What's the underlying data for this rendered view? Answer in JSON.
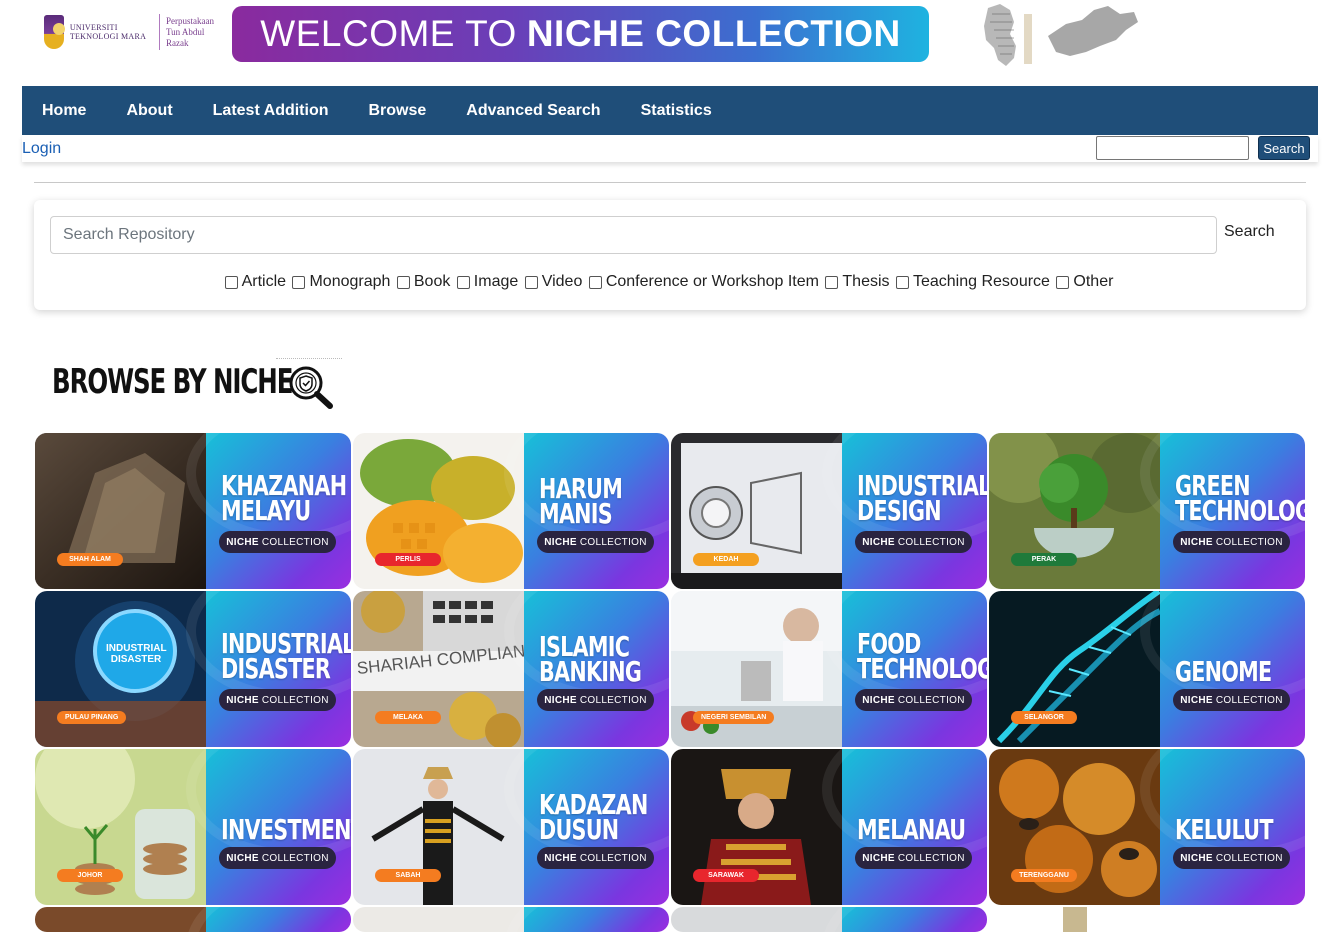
{
  "header": {
    "university_name": "UNIVERSITI TEKNOLOGI MARA",
    "library_name_line1": "Perpustakaan",
    "library_name_line2": "Tun Abdul Razak",
    "banner_light": "WELCOME TO",
    "banner_bold": "NICHE COLLECTION"
  },
  "nav": {
    "items": [
      "Home",
      "About",
      "Latest Addition",
      "Browse",
      "Advanced Search",
      "Statistics"
    ]
  },
  "subbar": {
    "login_label": "Login",
    "search_button_label": "Search"
  },
  "repository_search": {
    "placeholder": "Search Repository",
    "button_label": "Search",
    "filters": [
      "Article",
      "Monograph",
      "Book",
      "Image",
      "Video",
      "Conference or Workshop Item",
      "Thesis",
      "Teaching Resource",
      "Other"
    ]
  },
  "browse": {
    "title": "BROWSE BY NICHE",
    "pill_bold": "NICHE",
    "pill_rest": "COLLECTION",
    "tiles": [
      {
        "line1": "KHAZANAH",
        "line2": "MELAYU",
        "location": "SHAH ALAM",
        "loc_color": "#f47c20"
      },
      {
        "line1": "HARUM",
        "line2": "MANIS",
        "location": "PERLIS",
        "loc_color": "#e8262d"
      },
      {
        "line1": "INDUSTRIAL",
        "line2": "DESIGN",
        "location": "KEDAH",
        "loc_color": "#f4a020"
      },
      {
        "line1": "GREEN",
        "line2": "TECHNOLOGY",
        "location": "PERAK",
        "loc_color": "#1f7a3a"
      },
      {
        "line1": "INDUSTRIAL",
        "line2": "DISASTER",
        "location": "PULAU PINANG",
        "loc_color": "#f47c20"
      },
      {
        "line1": "ISLAMIC",
        "line2": "BANKING",
        "location": "MELAKA",
        "loc_color": "#f47c20"
      },
      {
        "line1": "FOOD",
        "line2": "TECHNOLOGY",
        "location": "NEGERI SEMBILAN",
        "loc_color": "#f47c20"
      },
      {
        "line1": "",
        "line2": "GENOME",
        "location": "SELANGOR",
        "loc_color": "#f47c20"
      },
      {
        "line1": "",
        "line2": "INVESTMENT",
        "location": "JOHOR",
        "loc_color": "#f47c20"
      },
      {
        "line1": "KADAZAN",
        "line2": "DUSUN",
        "location": "SABAH",
        "loc_color": "#f47c20"
      },
      {
        "line1": "",
        "line2": "MELANAU",
        "location": "SARAWAK",
        "loc_color": "#e8262d"
      },
      {
        "line1": "",
        "line2": "KELULUT",
        "location": "TERENGGANU",
        "loc_color": "#f47c20"
      }
    ],
    "disaster_badge_line1": "INDUSTRIAL",
    "disaster_badge_line2": "DISASTER",
    "shariah_text": "SHARIAH COMPLIANT"
  },
  "colors": {
    "nav_bg": "#1f4e79",
    "link": "#1a5fb4",
    "panel_gradient_start": "#17c0d8",
    "panel_gradient_end": "#9a2ee0"
  }
}
